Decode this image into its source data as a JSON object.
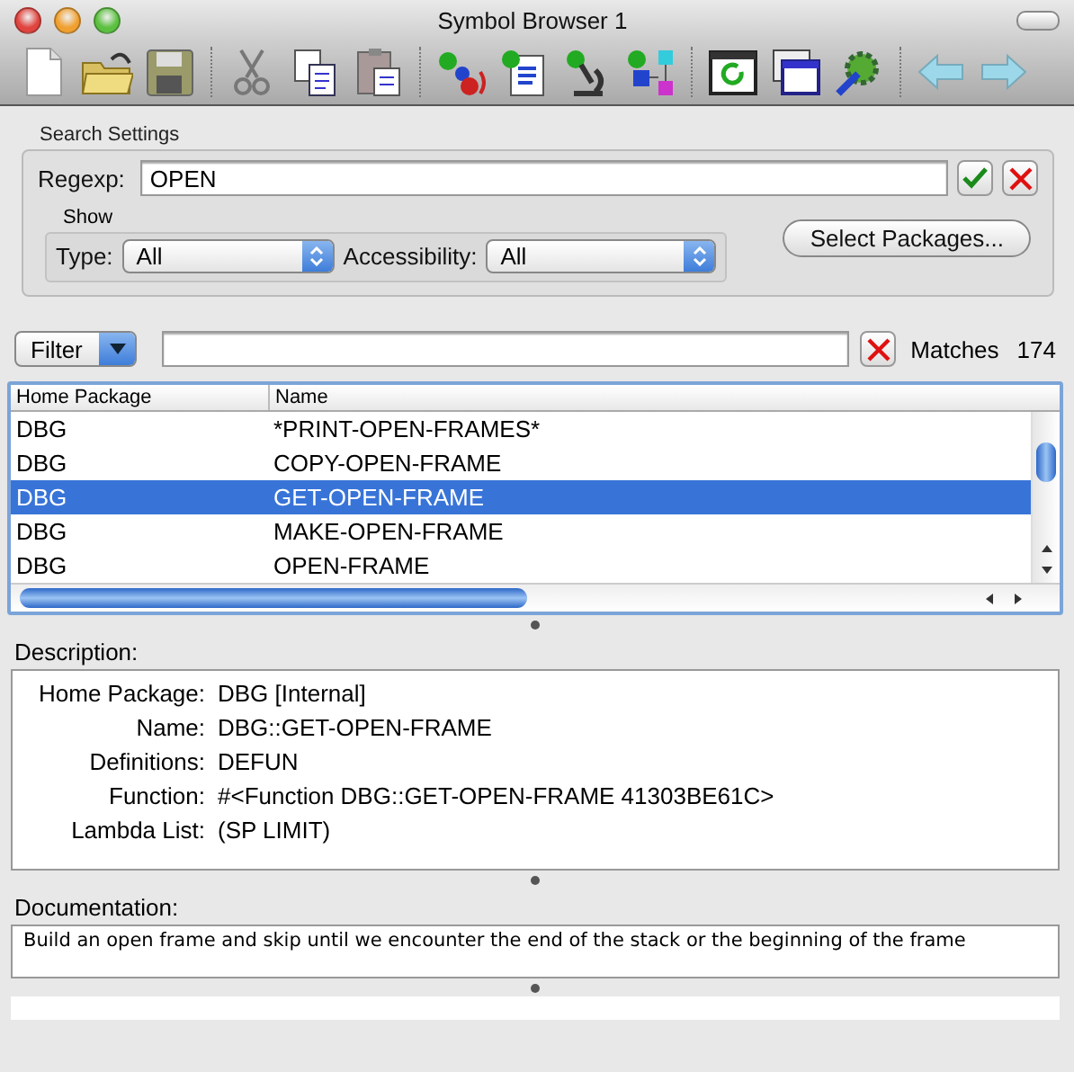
{
  "window": {
    "title": "Symbol Browser 1"
  },
  "search_settings": {
    "title": "Search Settings",
    "regexp": {
      "label": "Regexp:",
      "value": "OPEN"
    },
    "show": {
      "title": "Show",
      "type": {
        "label": "Type:",
        "value": "All"
      },
      "accessibility": {
        "label": "Accessibility:",
        "value": "All"
      }
    },
    "select_packages_button": "Select Packages..."
  },
  "filter": {
    "button": "Filter",
    "matches_label": "Matches",
    "matches_count": "174"
  },
  "table": {
    "columns": [
      "Home Package",
      "Name"
    ],
    "rows": [
      {
        "home_package": "DBG",
        "name": "*PRINT-OPEN-FRAMES*",
        "selected": false
      },
      {
        "home_package": "DBG",
        "name": "COPY-OPEN-FRAME",
        "selected": false
      },
      {
        "home_package": "DBG",
        "name": "GET-OPEN-FRAME",
        "selected": true
      },
      {
        "home_package": "DBG",
        "name": "MAKE-OPEN-FRAME",
        "selected": false
      },
      {
        "home_package": "DBG",
        "name": "OPEN-FRAME",
        "selected": false
      }
    ]
  },
  "description": {
    "label": "Description:",
    "fields": [
      {
        "label": "Home Package:",
        "value": "DBG [Internal]"
      },
      {
        "label": "Name:",
        "value": "DBG::GET-OPEN-FRAME"
      },
      {
        "label": "Definitions:",
        "value": "DEFUN"
      },
      {
        "label": "Function:",
        "value": "#<Function DBG::GET-OPEN-FRAME 41303BE61C>"
      },
      {
        "label": "Lambda List:",
        "value": "(SP LIMIT)"
      }
    ]
  },
  "documentation": {
    "label": "Documentation:",
    "text": "Build an open frame and skip until we encounter the end of the stack or the beginning of the frame"
  }
}
